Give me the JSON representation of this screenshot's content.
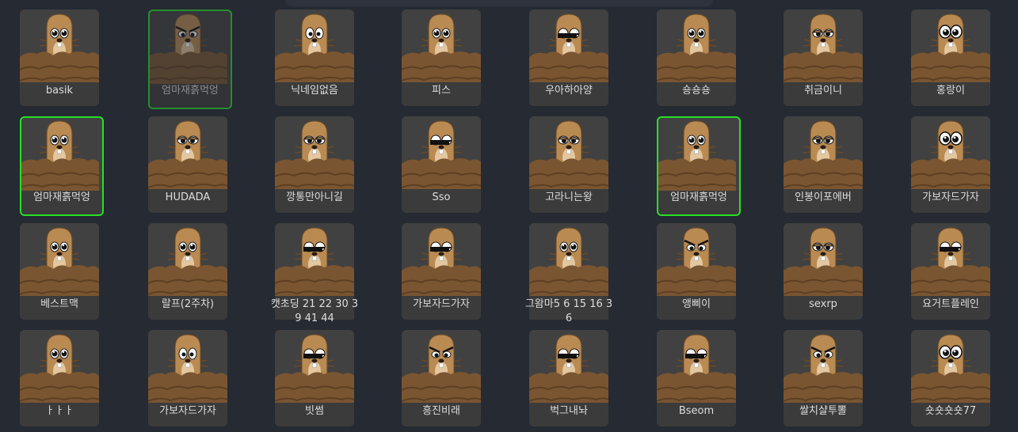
{
  "players": [
    {
      "name": "basik",
      "eyes": "normal",
      "selected": false,
      "dim": false
    },
    {
      "name": "엄마재흙먹엉",
      "eyes": "angry",
      "selected": true,
      "dim": true
    },
    {
      "name": "닉네임없음",
      "eyes": "white",
      "selected": false,
      "dim": false
    },
    {
      "name": "피스",
      "eyes": "normal",
      "selected": false,
      "dim": false
    },
    {
      "name": "우아하아양",
      "eyes": "shades",
      "selected": false,
      "dim": false
    },
    {
      "name": "숑숑숑",
      "eyes": "normal",
      "selected": false,
      "dim": false
    },
    {
      "name": "취금이니",
      "eyes": "lidded",
      "selected": false,
      "dim": false
    },
    {
      "name": "홍랑이",
      "eyes": "big",
      "selected": false,
      "dim": false
    },
    {
      "name": "엄마재흙먹엉",
      "eyes": "normal",
      "selected": true,
      "dim": false
    },
    {
      "name": "HUDADA",
      "eyes": "lidded",
      "selected": false,
      "dim": false
    },
    {
      "name": "깡통만아니길",
      "eyes": "lidded",
      "selected": false,
      "dim": false
    },
    {
      "name": "Sso",
      "eyes": "shades",
      "selected": false,
      "dim": false
    },
    {
      "name": "고라니는왕",
      "eyes": "lidded",
      "selected": false,
      "dim": false
    },
    {
      "name": "엄마재흙먹엉",
      "eyes": "normal",
      "selected": true,
      "dim": false
    },
    {
      "name": "인봉이포에버",
      "eyes": "lidded",
      "selected": false,
      "dim": false
    },
    {
      "name": "가보자드가자",
      "eyes": "big",
      "selected": false,
      "dim": false
    },
    {
      "name": "베스트맥",
      "eyes": "normal",
      "selected": false,
      "dim": false
    },
    {
      "name": "랄프(2주차)",
      "eyes": "normal",
      "selected": false,
      "dim": false
    },
    {
      "name": "캣초딩 21 22 30 39 41 44",
      "eyes": "shades",
      "selected": false,
      "dim": false
    },
    {
      "name": "가보자드가자",
      "eyes": "shades",
      "selected": false,
      "dim": false
    },
    {
      "name": "그왐마5 6 15 16 36",
      "eyes": "normal",
      "selected": false,
      "dim": false
    },
    {
      "name": "앵삐이",
      "eyes": "angry",
      "selected": false,
      "dim": false
    },
    {
      "name": "sexrp",
      "eyes": "lidded",
      "selected": false,
      "dim": false
    },
    {
      "name": "요거트플레인",
      "eyes": "shades",
      "selected": false,
      "dim": false
    },
    {
      "name": "ㅏㅏㅏ",
      "eyes": "normal",
      "selected": false,
      "dim": false
    },
    {
      "name": "가보자드가자",
      "eyes": "white",
      "selected": false,
      "dim": false
    },
    {
      "name": "빗썸",
      "eyes": "shades",
      "selected": false,
      "dim": false
    },
    {
      "name": "흥진비래",
      "eyes": "angry",
      "selected": false,
      "dim": false
    },
    {
      "name": "벅그내놔",
      "eyes": "shades",
      "selected": false,
      "dim": false
    },
    {
      "name": "Bseom",
      "eyes": "shades",
      "selected": false,
      "dim": false
    },
    {
      "name": "쌀치샬투뽈",
      "eyes": "angry",
      "selected": false,
      "dim": false
    },
    {
      "name": "숏숏숏숏77",
      "eyes": "big",
      "selected": false,
      "dim": false
    }
  ],
  "colors": {
    "background": "#252a33",
    "card": "#414141",
    "selected_border": "#27e127",
    "mole": "#b98a52",
    "dirt": "#7a5531",
    "dirt_dark": "#5d3f23"
  }
}
